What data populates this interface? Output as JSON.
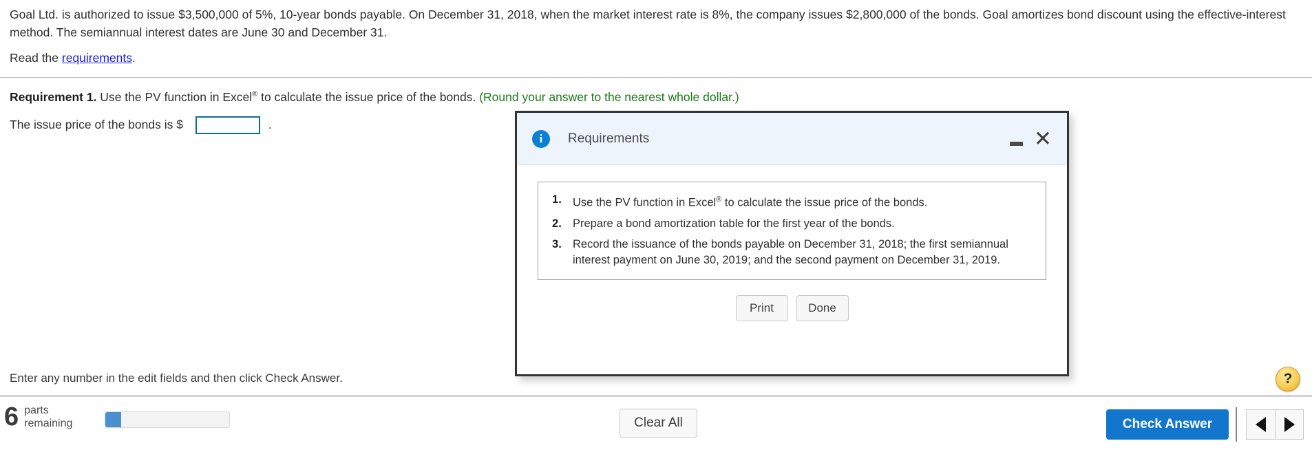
{
  "problem": {
    "statement": "Goal Ltd. is authorized to issue $3,500,000 of 5%, 10-year bonds payable. On December 31, 2018, when the market interest rate is 8%, the company issues $2,800,000 of the bonds. Goal amortizes bond discount using the effective-interest method. The semiannual interest dates are June 30 and December 31.",
    "read_prefix": "Read the ",
    "read_link": "requirements",
    "read_suffix": "."
  },
  "requirement1": {
    "label": "Requirement 1.",
    "text_before_sup": " Use the PV function in Excel",
    "sup": "®",
    "text_after_sup": " to calculate the issue price of the bonds. ",
    "rounding_note": "(Round your answer to the nearest whole dollar.)",
    "answer_prompt": "The issue price of the bonds is $",
    "answer_value": "",
    "answer_placeholder": "",
    "answer_period": "."
  },
  "modal": {
    "title": "Requirements",
    "info_icon": "info-icon",
    "minimize_label": "minimize",
    "close_label": "✕",
    "items": [
      "Use the PV function in Excel® to calculate the issue price of the bonds.",
      "Prepare a bond amortization table for the first year of the bonds.",
      "Record the issuance of the bonds payable on December 31, 2018; the first semiannual interest payment on June 30, 2019; and the second payment on December 31, 2019."
    ],
    "item1_before_sup": "Use the PV function in Excel",
    "item1_sup": "®",
    "item1_after_sup": " to calculate the issue price of the bonds.",
    "print_label": "Print",
    "done_label": "Done"
  },
  "footer": {
    "hint": "Enter any number in the edit fields and then click Check Answer.",
    "parts_number": "6",
    "parts_label_line1": "parts",
    "parts_label_line2": "remaining",
    "progress_percent": 13,
    "clear_all_label": "Clear All",
    "check_answer_label": "Check Answer",
    "prev_icon": "triangle-left-icon",
    "next_icon": "triangle-right-icon",
    "help_label": "?"
  },
  "colors": {
    "link": "#1a1ae6",
    "note_green": "#1a7a1a",
    "input_border": "#0b6e8f",
    "primary_button": "#1277cc",
    "progress_fill": "#4a90ce",
    "modal_header": "#eef4fc",
    "help_yellow": "#f7cf56"
  }
}
